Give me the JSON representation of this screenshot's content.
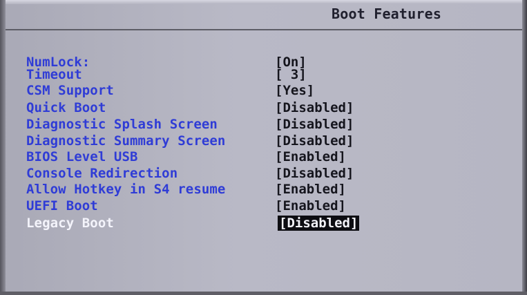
{
  "header": {
    "title": "Boot Features"
  },
  "settings": [
    {
      "label": "NumLock:",
      "value": "[On]"
    },
    {
      "label": "Timeout",
      "value": "[ 3]"
    },
    {
      "label": "CSM Support",
      "value": "[Yes]"
    },
    {
      "label": "Quick Boot",
      "value": "[Disabled]"
    },
    {
      "label": "Diagnostic Splash Screen",
      "value": "[Disabled]"
    },
    {
      "label": "Diagnostic Summary Screen",
      "value": "[Disabled]"
    },
    {
      "label": "BIOS Level USB",
      "value": "[Enabled]"
    },
    {
      "label": "Console Redirection",
      "value": "[Disabled]"
    },
    {
      "label": "Allow Hotkey in S4 resume",
      "value": "[Enabled]"
    },
    {
      "label": "UEFI Boot",
      "value": "[Enabled]"
    },
    {
      "label": "Legacy Boot",
      "value": "[Disabled]",
      "selected": true
    }
  ],
  "colors": {
    "label": "#2f3cd6",
    "selected_label": "#f4f4fb",
    "value": "#15151d",
    "highlight_bg": "#0d0d12",
    "background": "#b9b9c6"
  }
}
